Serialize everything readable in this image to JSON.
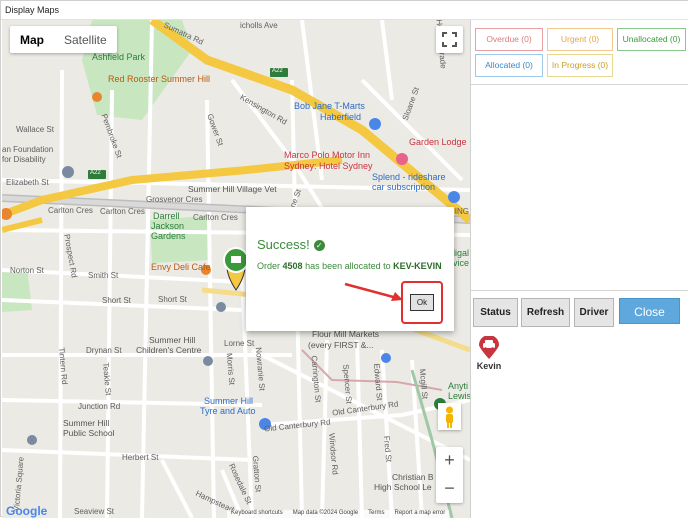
{
  "window": {
    "title": "Display Maps"
  },
  "map": {
    "map_type_buttons": [
      "Map",
      "Satellite"
    ],
    "selected_map_type": "Map",
    "zoom_in": "+",
    "zoom_out": "−",
    "google_logo": "Google",
    "footer": [
      "Keyboard shortcuts",
      "Map data ©2024 Google",
      "Terms",
      "Report a map error"
    ],
    "labels": {
      "sumatra_rd": "Sumatra Rd",
      "nicholls_ave": "icholls Ave",
      "ashfield_park": "Ashfield Park",
      "red_rooster": "Red Rooster Summer Hill",
      "bob_jane": "Bob Jane T-Marts",
      "haberfield": "Haberfield",
      "kensington_rd": "Kensington Rd",
      "wallace_st": "Wallace St",
      "pembroke_st": "Pembroke St",
      "gower_st": "Gower St",
      "sloane_st": "Sloane St",
      "garden_lodge": "Garden Lodge",
      "foundation_1": "an Foundation",
      "foundation_2": "for Disability",
      "marco_polo_1": "Marco Polo Motor Inn",
      "marco_polo_2": "Sydney: Hotel Sydney",
      "splend_1": "Splend - rideshare",
      "splend_2": "car subscription",
      "elizabeth_st": "Elizabeth St",
      "a22_top": "A22",
      "a22_left": "A22",
      "vet": "Summer Hill Village Vet",
      "grosvenor_cres": "Grosvenor Cres",
      "carlton_cres_1": "Carlton Cres",
      "carlton_cres_2": "Carlton Cres",
      "carlton_cres_3": "Carlton Cres",
      "darrell_1": "Darrell",
      "darrell_2": "Jackson",
      "darrell_3": "Gardens",
      "prospect_rd": "Prospect Rd",
      "norton_st": "Norton St",
      "smith_st": "Smith St",
      "envy_deli": "Envy Deli Cafe",
      "short_st_1": "Short St",
      "short_st_2": "Short St",
      "drynan_st": "Drynan St",
      "childrens_1": "Summer Hill",
      "childrens_2": "Children's Centre",
      "flour_mill_1": "Flour Mill Markets",
      "flour_mill_2": "(every FIRST &...",
      "lorne_st": "Lorne St",
      "tintern_rd": "Tintern Rd",
      "teakle_st": "Teakle St",
      "junction_rd": "Junction Rd",
      "morris_st": "Morris St",
      "nowranie_st": "Nowranie St",
      "carrington_st": "Carrington St",
      "spencer_st": "Spencer St",
      "edward_st": "Edward St",
      "mcgill_st": "Mcgill St",
      "anytime_1": "Anyti",
      "anytime_2": "Lewis",
      "tyre_1": "Summer Hill",
      "tyre_2": "Tyre and Auto",
      "public_school_1": "Summer Hill",
      "public_school_2": "Public School",
      "old_canterbury_rd_1": "Old Canterbury Rd",
      "old_canterbury_rd_2": "Old Canterbury Rd",
      "windsor_rd": "Windsor Rd",
      "fred_st": "Fred St",
      "herbert_st": "Herbert St",
      "victoria_square": "Victoria Square",
      "gratton_st": "Gratton St",
      "rosedale_st": "Rosedale St",
      "hampstead": "Hampstead",
      "seaview_st": "Seaview St",
      "christian_1": "Christian B",
      "christian_2": "High School Le",
      "ring_st": "RING S",
      "adigal_1": "digal",
      "adigal_2": "rvice",
      "home_parade": "Home Parade",
      "street_near_sloane": "Sloane St"
    }
  },
  "dialog": {
    "title": "Success!",
    "message_prefix": "Order",
    "order_number": "4508",
    "message_middle": "has been allocated to",
    "driver_code": "KEV-KEVIN",
    "ok_label": "Ok"
  },
  "status_filters": [
    {
      "label": "Overdue (0)",
      "color": "#e07a7a"
    },
    {
      "label": "Urgent (0)",
      "color": "#e8a34a"
    },
    {
      "label": "Unallocated (0)",
      "color": "#3a9a3a"
    },
    {
      "label": "Allocated (0)",
      "color": "#3a86c8"
    },
    {
      "label": "In Progress (0)",
      "color": "#c9a020"
    }
  ],
  "panel_buttons": {
    "status": "Status",
    "refresh": "Refresh",
    "driver": "Driver",
    "close": "Close"
  },
  "drivers": [
    {
      "name": "Kevin"
    }
  ],
  "colors": {
    "accent": "#5fa8dd",
    "success": "#3d8b3d",
    "highlight": "#e0302f",
    "marker_red": "#c8343f"
  }
}
